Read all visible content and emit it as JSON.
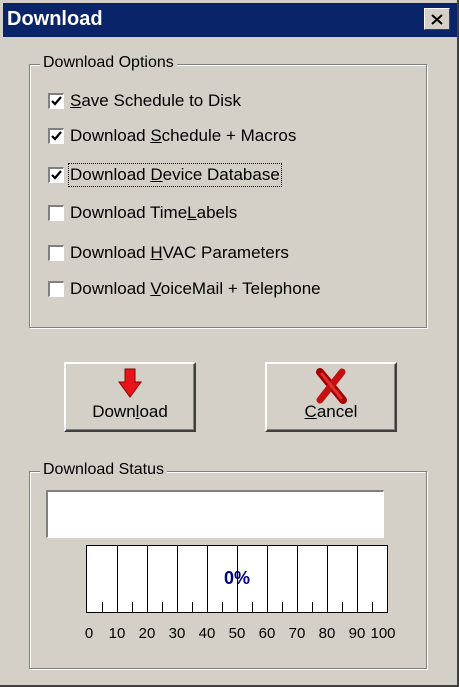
{
  "window": {
    "title": "Download"
  },
  "options": {
    "legend": "Download Options",
    "items": [
      {
        "pre": "",
        "key": "S",
        "post": "ave Schedule to Disk",
        "checked": true
      },
      {
        "pre": "Download ",
        "key": "S",
        "post": "chedule + Macros",
        "checked": true
      },
      {
        "pre": "Download ",
        "key": "D",
        "post": "evice Database",
        "checked": true
      },
      {
        "pre": "Download Time",
        "key": "L",
        "post": "abels",
        "checked": false
      },
      {
        "pre": "Download ",
        "key": "H",
        "post": "VAC Parameters",
        "checked": false
      },
      {
        "pre": "Download ",
        "key": "V",
        "post": "oiceMail + Telephone",
        "checked": false
      }
    ]
  },
  "buttons": {
    "download": {
      "pre": "Down",
      "key": "l",
      "post": "oad"
    },
    "cancel": {
      "pre": "",
      "key": "C",
      "post": "ancel"
    }
  },
  "status": {
    "legend": "Download Status",
    "message": "",
    "progress_percent": 0,
    "progress_label": "0%",
    "scale": [
      "0",
      "10",
      "20",
      "30",
      "40",
      "50",
      "60",
      "70",
      "80",
      "90",
      "100"
    ]
  },
  "icons": {
    "download": "down-arrow-icon",
    "cancel": "red-x-icon",
    "close": "close-icon"
  }
}
